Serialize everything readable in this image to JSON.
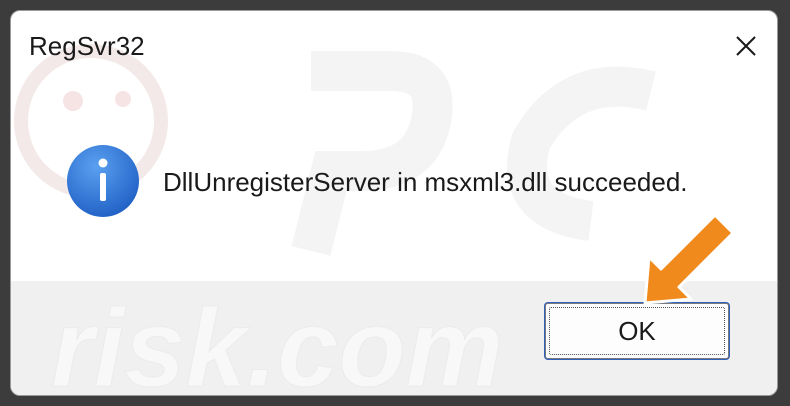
{
  "dialog": {
    "title": "RegSvr32",
    "message": "DllUnregisterServer in msxml3.dll succeeded.",
    "ok_label": "OK"
  },
  "icons": {
    "info": "info-icon",
    "close": "close-icon",
    "arrow": "pointer-arrow-icon"
  },
  "colors": {
    "info_icon_blue": "#2f6fd0",
    "arrow_orange": "#f08a1c",
    "footer_gray": "#f0f0f0"
  }
}
